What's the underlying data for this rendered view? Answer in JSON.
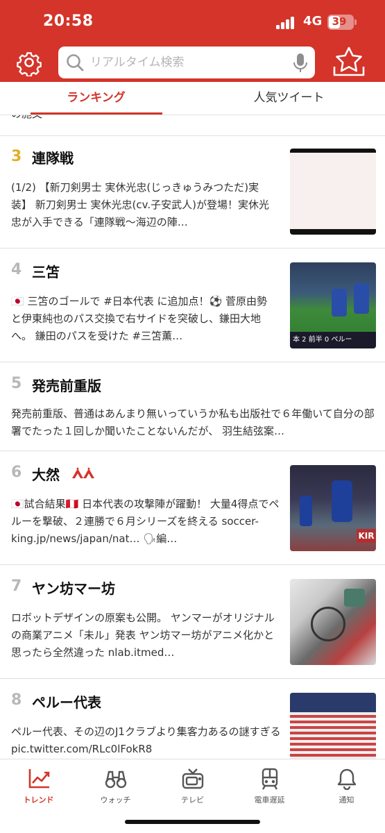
{
  "status": {
    "time": "20:58",
    "network": "4G",
    "battery": "39"
  },
  "search": {
    "placeholder": "リアルタイム検索"
  },
  "tabs": [
    {
      "label": "ランキング"
    },
    {
      "label": "人気ツイート"
    }
  ],
  "partial_text": "の施文",
  "items": [
    {
      "rank": "3",
      "title": "連隊戦",
      "desc": "(1/2) 【新刀剣男士 実休光忠(じっきゅうみつただ)実装】 新刀剣男士 実休光忠(cv.子安武人)が登場！実休光忠が入手できる「連隊戦〜海辺の陣…"
    },
    {
      "rank": "4",
      "title": "三笘",
      "desc": "🇯🇵 三笘のゴールで #日本代表 に追加点！⚽ 菅原由勢と伊東純也のパス交換で右サイドを突破し、鎌田大地へ。 鎌田のパスを受けた #三笘薫…",
      "thumb_caption": "本  2  前半  0  ペルー"
    },
    {
      "rank": "5",
      "title": "発売前重版",
      "desc": "発売前重版、普通はあんまり無いっていうか私も出版社で６年働いて自分の部署でたった１回しか聞いたことないんだが、 羽生結弦案…"
    },
    {
      "rank": "6",
      "title": "大然",
      "desc": "🇯🇵試合結果🇵🇪 日本代表の攻撃陣が躍動！ 大量4得点でペルーを撃破、２連勝で６月シリーズを終える soccer-king.jp/news/japan/nat… 🗣編…",
      "thumb_caption": "KIR"
    },
    {
      "rank": "7",
      "title": "ヤン坊マー坊",
      "desc": "ロボットデザインの原案も公開。 ヤンマーがオリジナルの商業アニメ「未ル」発表 ヤン坊マー坊がアニメ化かと思ったら全然違った nlab.itmed…"
    },
    {
      "rank": "8",
      "title": "ペルー代表",
      "desc": "ペルー代表、その辺のJ1クラブより集客力あるの謎すぎる pic.twitter.com/RLc0lFokR8"
    }
  ],
  "tabbar": [
    {
      "label": "トレンド",
      "icon": "trend-chart-icon"
    },
    {
      "label": "ウォッチ",
      "icon": "binoculars-icon"
    },
    {
      "label": "テレビ",
      "icon": "tv-icon"
    },
    {
      "label": "電車遅延",
      "icon": "train-icon"
    },
    {
      "label": "通知",
      "icon": "bell-icon"
    }
  ],
  "colors": {
    "brand": "#d4342a",
    "gold": "#e0b12a",
    "gray_rank": "#b8b8b8"
  }
}
